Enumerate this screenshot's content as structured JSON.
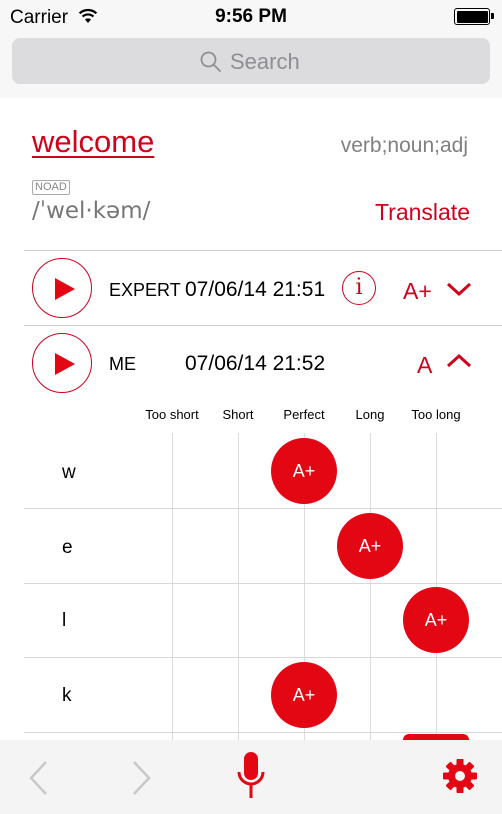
{
  "status_bar": {
    "carrier": "Carrier",
    "time": "9:56 PM"
  },
  "search": {
    "placeholder": "Search"
  },
  "entry": {
    "word": "welcome",
    "parts_of_speech": "verb;noun;adj",
    "dictionary": "NOAD",
    "pronunciation": "/ˈwel·kəm/",
    "translate_label": "Translate"
  },
  "recordings": [
    {
      "speaker": "EXPERT",
      "datetime": "07/06/14 21:51",
      "grade": "A+",
      "expanded": false
    },
    {
      "speaker": "ME",
      "datetime": "07/06/14 21:52",
      "grade": "A",
      "expanded": true
    }
  ],
  "duration_scale": {
    "columns": [
      "Too short",
      "Short",
      "Perfect",
      "Long",
      "Too long"
    ],
    "rows": [
      {
        "phoneme": "w",
        "grade": "A+",
        "duration": "Perfect"
      },
      {
        "phoneme": "e",
        "grade": "A+",
        "duration": "Long"
      },
      {
        "phoneme": "l",
        "grade": "A+",
        "duration": "Too long"
      },
      {
        "phoneme": "k",
        "grade": "A+",
        "duration": "Perfect"
      }
    ]
  },
  "toolbar": {
    "icons": [
      "back-icon",
      "forward-icon",
      "microphone-icon",
      "settings-icon"
    ]
  },
  "colors": {
    "accent": "#d0021b",
    "bubble": "#e30613",
    "disabled": "#c8c8c8"
  }
}
